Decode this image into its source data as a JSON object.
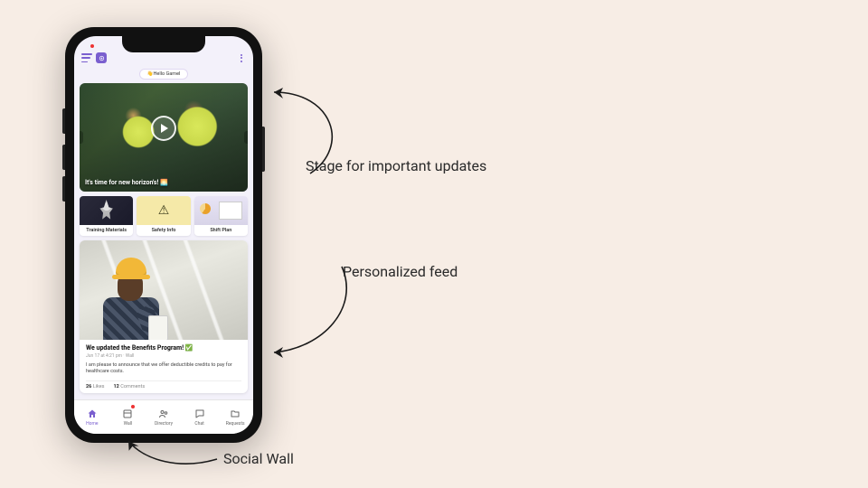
{
  "topbar": {
    "menu_icon": "hamburger-icon",
    "app_icon": "spiral-logo-icon",
    "more_icon": "more-vertical-icon"
  },
  "greeting": {
    "wave": "👋",
    "text": "Hello Gamel"
  },
  "hero": {
    "caption": "It's time for new horizon's! 🌅",
    "play_icon": "play-icon",
    "prev_icon": "chevron-left-icon",
    "next_icon": "chevron-right-icon"
  },
  "tiles": [
    {
      "label": "Training Materials"
    },
    {
      "label": "Safety Info"
    },
    {
      "label": "Shift Plan"
    }
  ],
  "post": {
    "title": "We updated the Benefits Program! ✅",
    "meta": "Jun 17 at 4:21 pm · Wall",
    "body": "I am please to announce that we  offer deductible credits to pay for healthcare costs.",
    "likes_count": "26",
    "likes_label": "Likes",
    "comments_count": "12",
    "comments_label": "Comments"
  },
  "nav": {
    "items": [
      {
        "label": "Home",
        "icon": "home-icon",
        "active": true,
        "badge": false
      },
      {
        "label": "Wall",
        "icon": "wall-icon",
        "active": false,
        "badge": true
      },
      {
        "label": "Directory",
        "icon": "directory-icon",
        "active": false,
        "badge": false
      },
      {
        "label": "Chat",
        "icon": "chat-icon",
        "active": false,
        "badge": false
      },
      {
        "label": "Requests",
        "icon": "requests-icon",
        "active": false,
        "badge": false
      }
    ]
  },
  "annotations": {
    "a1": "Stage for important updates",
    "a2": "Personalized feed",
    "a3": "Social Wall"
  }
}
